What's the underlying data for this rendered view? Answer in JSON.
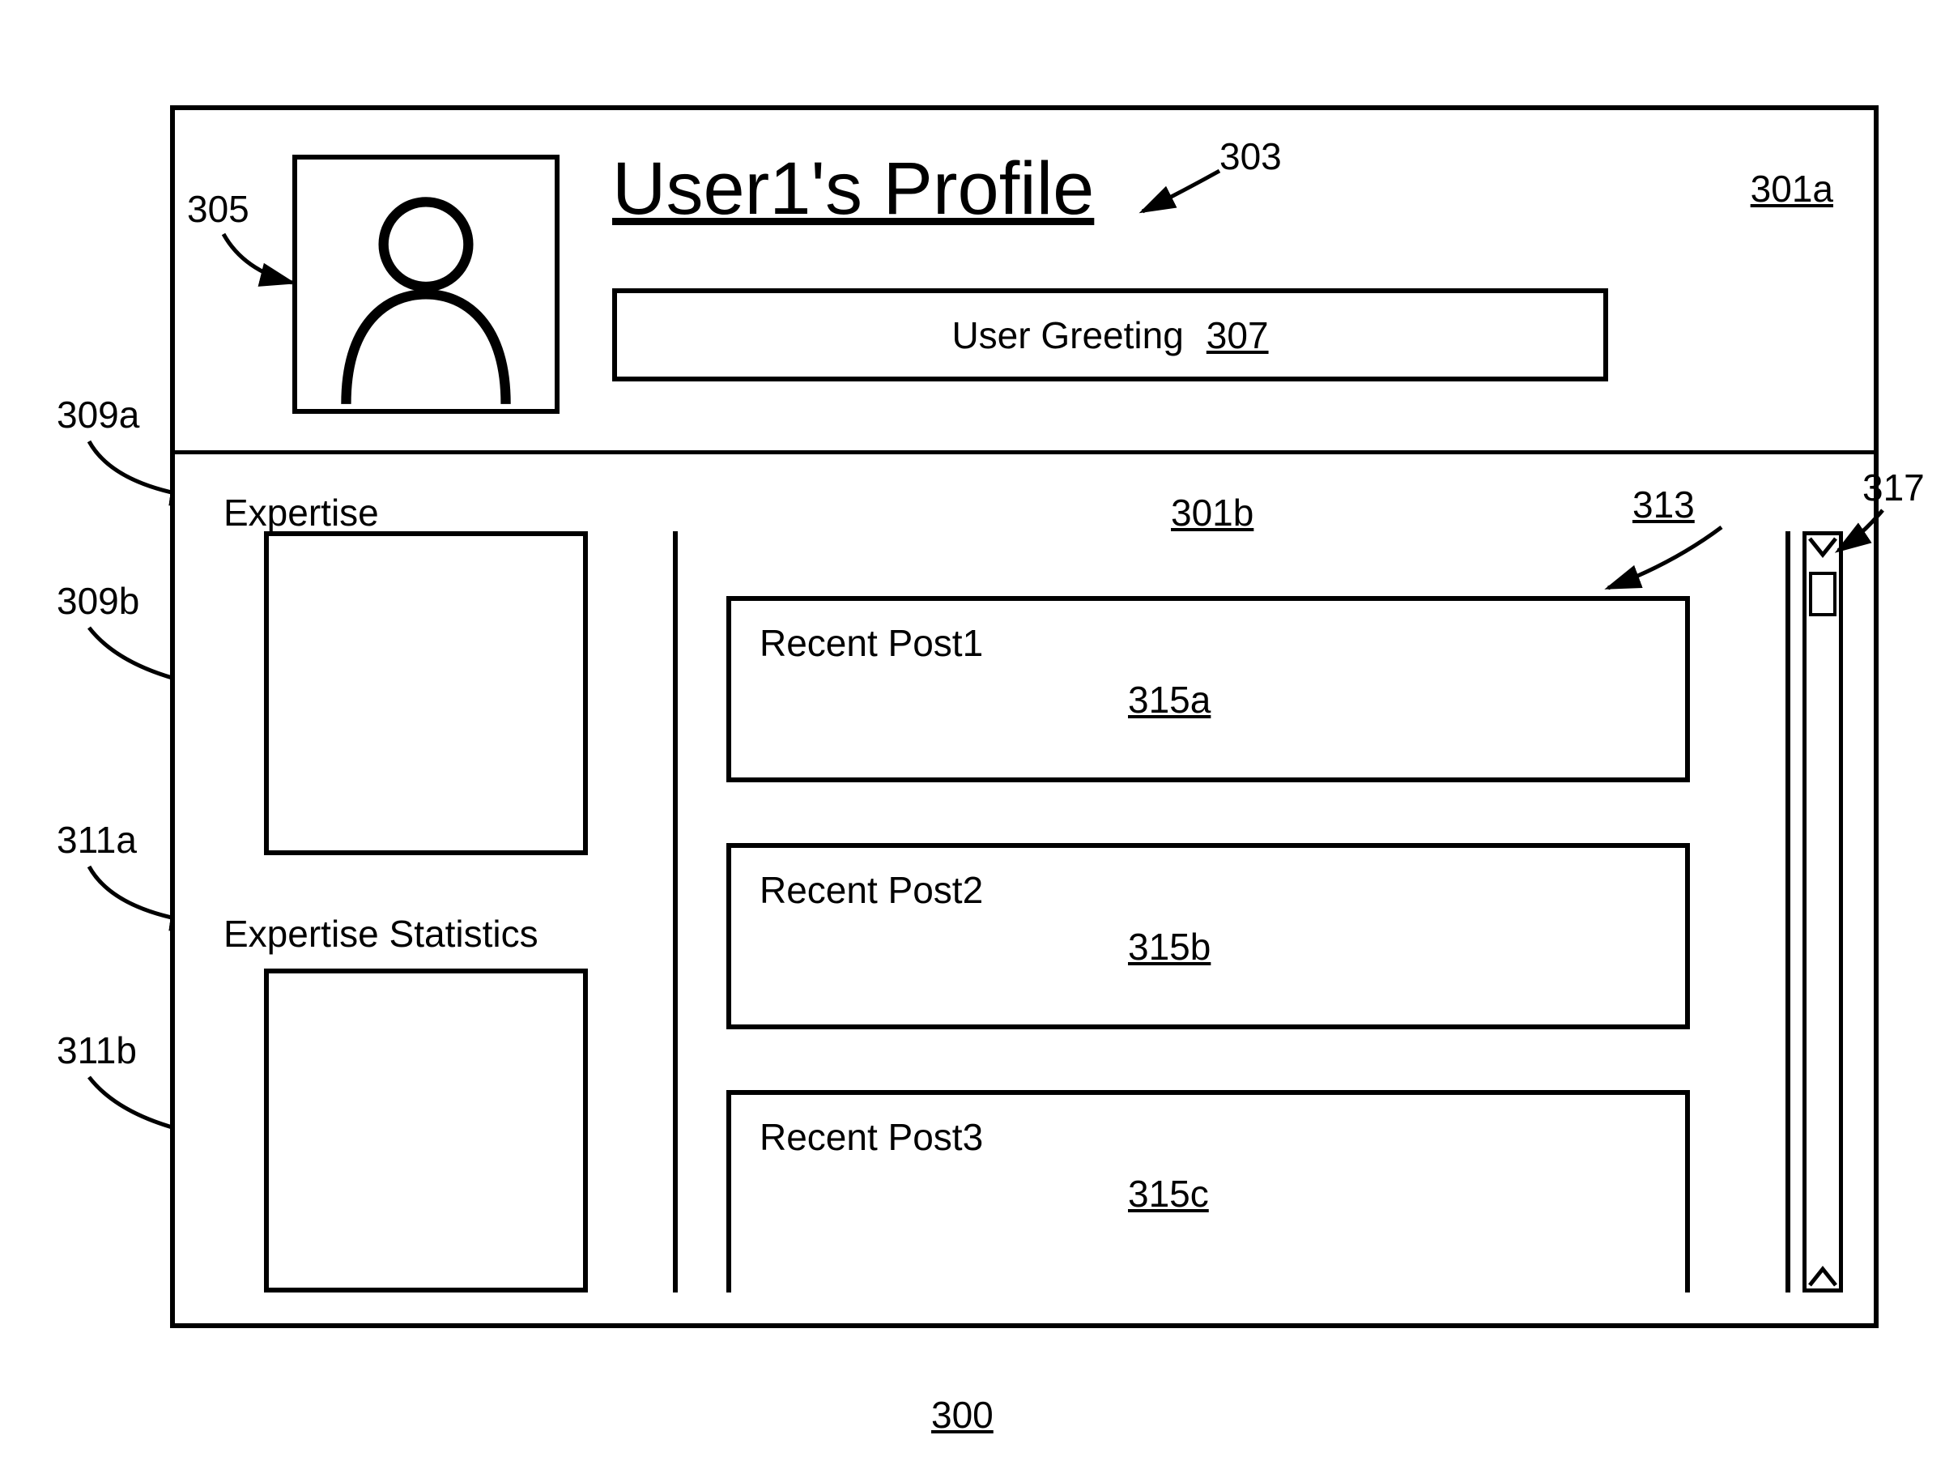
{
  "figure": {
    "number": "300"
  },
  "refs": {
    "r301a": "301a",
    "r301b": "301b",
    "r303": "303",
    "r305": "305",
    "r307": "307",
    "r309a": "309a",
    "r309b": "309b",
    "r311a": "311a",
    "r311b": "311b",
    "r313": "313",
    "r315a": "315a",
    "r315b": "315b",
    "r315c": "315c",
    "r317": "317"
  },
  "header": {
    "title": "User1's Profile",
    "greeting": "User Greeting"
  },
  "sidebar": {
    "expertise_label": "Expertise",
    "stats_label": "Expertise Statistics"
  },
  "activity": {
    "posts": [
      {
        "title": "Recent Post1"
      },
      {
        "title": "Recent Post2"
      },
      {
        "title": "Recent Post3"
      }
    ]
  }
}
